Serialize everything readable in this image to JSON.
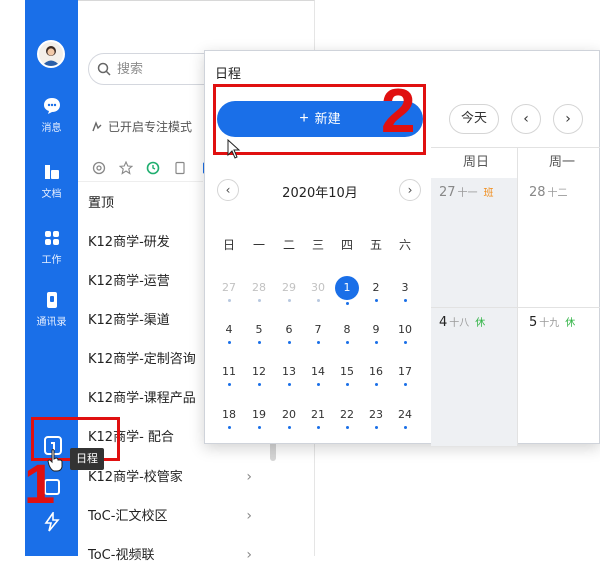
{
  "nav": {
    "items": [
      {
        "label": "消息",
        "icon": "chat-icon"
      },
      {
        "label": "文档",
        "icon": "docs-icon"
      },
      {
        "label": "工作",
        "icon": "apps-icon"
      },
      {
        "label": "通讯录",
        "icon": "contacts-icon"
      }
    ],
    "calendar_icon": "calendar-icon",
    "tooltip": "日程"
  },
  "list": {
    "search_placeholder": "搜索",
    "focus_mode": "已开启专注模式",
    "items": [
      {
        "label": "置顶"
      },
      {
        "label": "K12商学-研发"
      },
      {
        "label": "K12商学-运营"
      },
      {
        "label": "K12商学-渠道"
      },
      {
        "label": "K12商学-定制咨询"
      },
      {
        "label": "K12商学-课程产品"
      },
      {
        "label": "K12商学- 配合"
      },
      {
        "label": "K12商学-校管家"
      },
      {
        "label": "ToC-汇文校区"
      },
      {
        "label": "ToC-视频联"
      }
    ]
  },
  "calendar_popup": {
    "title": "日程",
    "new_button": "新建",
    "month": "2020年10月",
    "prev": "‹",
    "next": "›",
    "weekdays": [
      "日",
      "一",
      "二",
      "三",
      "四",
      "五",
      "六"
    ],
    "weeks": [
      [
        {
          "d": "27",
          "other": true
        },
        {
          "d": "28",
          "other": true
        },
        {
          "d": "29",
          "other": true
        },
        {
          "d": "30",
          "other": true
        },
        {
          "d": "1",
          "selected": true
        },
        {
          "d": "2"
        },
        {
          "d": "3"
        }
      ],
      [
        {
          "d": "4"
        },
        {
          "d": "5"
        },
        {
          "d": "6"
        },
        {
          "d": "7"
        },
        {
          "d": "8"
        },
        {
          "d": "9"
        },
        {
          "d": "10"
        }
      ],
      [
        {
          "d": "11"
        },
        {
          "d": "12"
        },
        {
          "d": "13"
        },
        {
          "d": "14"
        },
        {
          "d": "15"
        },
        {
          "d": "16"
        },
        {
          "d": "17"
        }
      ],
      [
        {
          "d": "18"
        },
        {
          "d": "19"
        },
        {
          "d": "20"
        },
        {
          "d": "21"
        },
        {
          "d": "22"
        },
        {
          "d": "23"
        },
        {
          "d": "24"
        }
      ]
    ],
    "today": "今天",
    "week_prev": "‹",
    "week_next": "›",
    "week_view": {
      "headers": [
        "周日",
        "周一"
      ],
      "row1": [
        {
          "day": "27",
          "lunar": "十一",
          "tag": "班",
          "tag_color": "#f08c1a"
        },
        {
          "day": "28",
          "lunar": "十二",
          "tag": "",
          "tag_color": ""
        }
      ],
      "row2": [
        {
          "day": "4",
          "lunar": "十八",
          "tag": "休",
          "tag_color": "#2fb344"
        },
        {
          "day": "5",
          "lunar": "十九",
          "tag": "休",
          "tag_color": "#2fb344"
        }
      ]
    }
  },
  "annotations": {
    "step1": "1",
    "step2": "2"
  },
  "colors": {
    "accent": "#1a6fe8",
    "annotation": "#e01010"
  }
}
